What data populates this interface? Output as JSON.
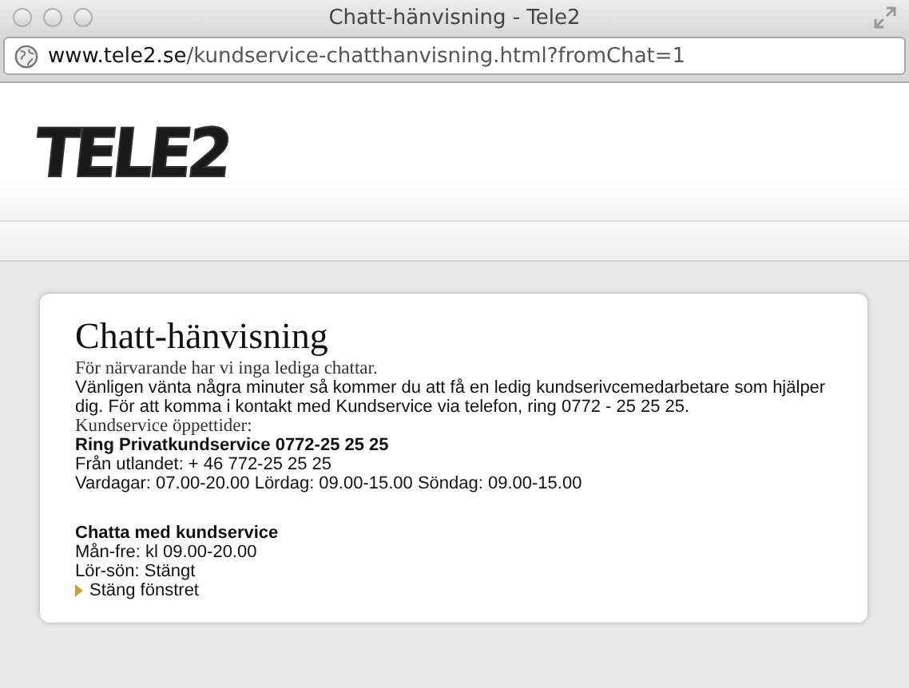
{
  "window": {
    "title": "Chatt-hänvisning - Tele2"
  },
  "address": {
    "domain": "www.tele2.se",
    "path": "/kundservice-chatthanvisning.html?fromChat=1"
  },
  "logo": {
    "text": "TELE2"
  },
  "card": {
    "title": "Chatt-hänvisning",
    "blocks": [
      {
        "lines": [
          {
            "kind": "serif",
            "text": "För närvarande har vi inga lediga chattar."
          },
          {
            "kind": "sans",
            "text": "Vänligen vänta några minuter så kommer du att få en ledig kundserivcemedarbetare som hjälper dig. För att komma i kontakt med Kundservice via telefon, ring 0772 - 25 25 25."
          },
          {
            "kind": "serif",
            "text": "Kundservice öppettider:"
          },
          {
            "kind": "bold",
            "text": "Ring Privatkundservice 0772-25 25 25"
          },
          {
            "kind": "sans",
            "text": "Från utlandet: + 46 772-25 25 25"
          },
          {
            "kind": "sans",
            "text": "Vardagar: 07.00-20.00 Lördag: 09.00-15.00 Söndag: 09.00-15.00"
          }
        ]
      },
      {
        "lines": [
          {
            "kind": "bold",
            "text": "Chatta med kundservice"
          },
          {
            "kind": "sans",
            "text": "Mån-fre: kl 09.00-20.00"
          },
          {
            "kind": "sans",
            "text": "Lör-sön: Stängt"
          }
        ]
      }
    ],
    "link": "Stäng fönstret"
  }
}
